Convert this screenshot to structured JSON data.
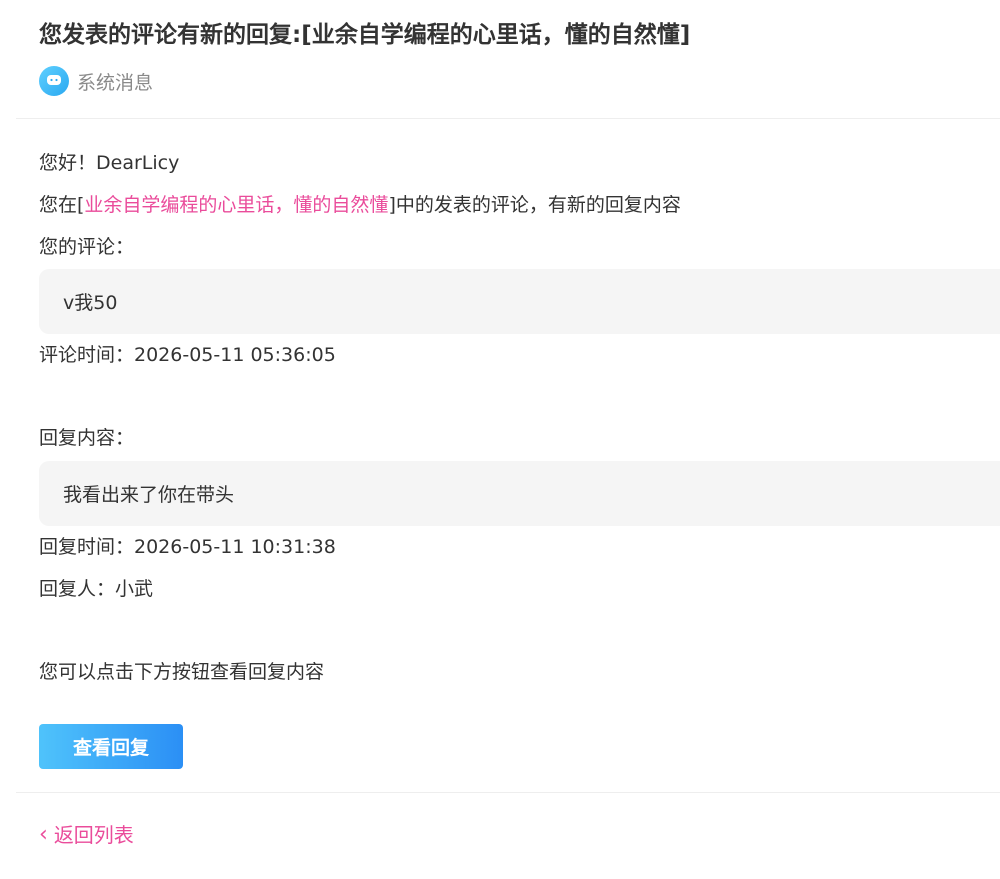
{
  "header": {
    "title": "您发表的评论有新的回复:[业余自学编程的心里话，懂的自然懂]",
    "sender_label": "系统消息",
    "sender_icon": "chat-bubble-icon"
  },
  "body": {
    "greeting": "您好！DearLicy",
    "intro_prefix": "您在[",
    "article_title": "业余自学编程的心里话，懂的自然懂",
    "intro_suffix": "]中的发表的评论，有新的回复内容",
    "your_comment_label": "您的评论：",
    "your_comment": "v我50",
    "comment_time": "评论时间：2026-05-11 05:36:05",
    "reply_label": "回复内容：",
    "reply_content": "我看出来了你在带头",
    "reply_time": "回复时间：2026-05-11 10:31:38",
    "replier": "回复人：小武",
    "hint": "您可以点击下方按钮查看回复内容"
  },
  "actions": {
    "view_reply": "查看回复",
    "back_to_list": "返回列表"
  },
  "colors": {
    "accent_pink": "#ea4c9b",
    "button_gradient_start": "#4fc3fb",
    "button_gradient_end": "#2b8ff5"
  }
}
